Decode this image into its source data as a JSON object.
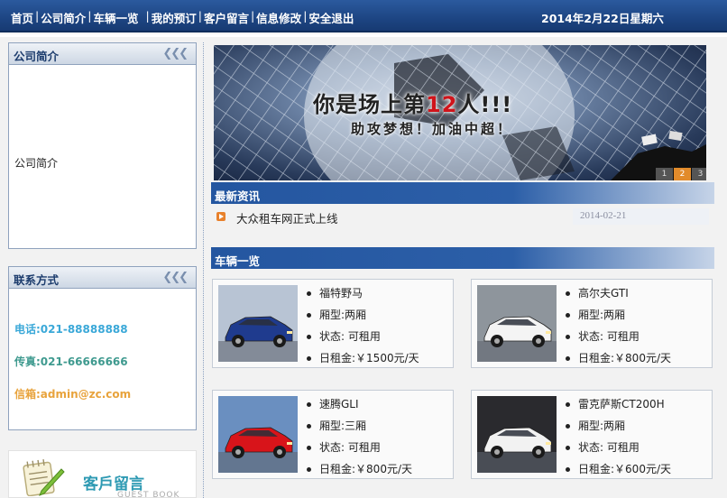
{
  "nav": {
    "items": [
      "首页",
      "公司简介",
      "车辆一览",
      "我的预订",
      "客户留言",
      "信息修改",
      "安全退出"
    ],
    "date": "2014年2月22日星期六"
  },
  "sidebar": {
    "about": {
      "title": "公司简介",
      "content": "公司简介"
    },
    "contact": {
      "title": "联系方式",
      "phone": "电话:021-88888888",
      "fax": "传真:021-66666666",
      "email": "信箱:admin@zc.com"
    },
    "guestbook": {
      "title": "客戶留言",
      "subtitle": "GUEST BOOK"
    }
  },
  "banner": {
    "line1_a": "你是场上第",
    "line1_b": "12",
    "line1_c": "人!!!",
    "line2": "助攻梦想！加油中超！",
    "slides": [
      "1",
      "2",
      "3"
    ],
    "active_slide": 1
  },
  "news": {
    "title": "最新资讯",
    "items": [
      {
        "title": "大众租车网正式上线",
        "date": "2014-02-21"
      }
    ]
  },
  "cars": {
    "title": "车辆一览",
    "items": [
      {
        "name": "福特野马",
        "type": "厢型:两厢",
        "status": "状态: 可租用",
        "price": "日租金:￥1500元/天",
        "color": "#1f3b8e",
        "bg": "#b8c4d4"
      },
      {
        "name": "高尔夫GTI",
        "type": "厢型:两厢",
        "status": "状态: 可租用",
        "price": "日租金:￥800元/天",
        "color": "#f4f4f4",
        "bg": "#8e959c"
      },
      {
        "name": "速腾GLI",
        "type": "厢型:三厢",
        "status": "状态: 可租用",
        "price": "日租金:￥800元/天",
        "color": "#d8141a",
        "bg": "#6a8fc0"
      },
      {
        "name": "雷克萨斯CT200H",
        "type": "厢型:两厢",
        "status": "状态: 可租用",
        "price": "日租金:￥600元/天",
        "color": "#f2f2f2",
        "bg": "#2a2a2e"
      }
    ]
  }
}
